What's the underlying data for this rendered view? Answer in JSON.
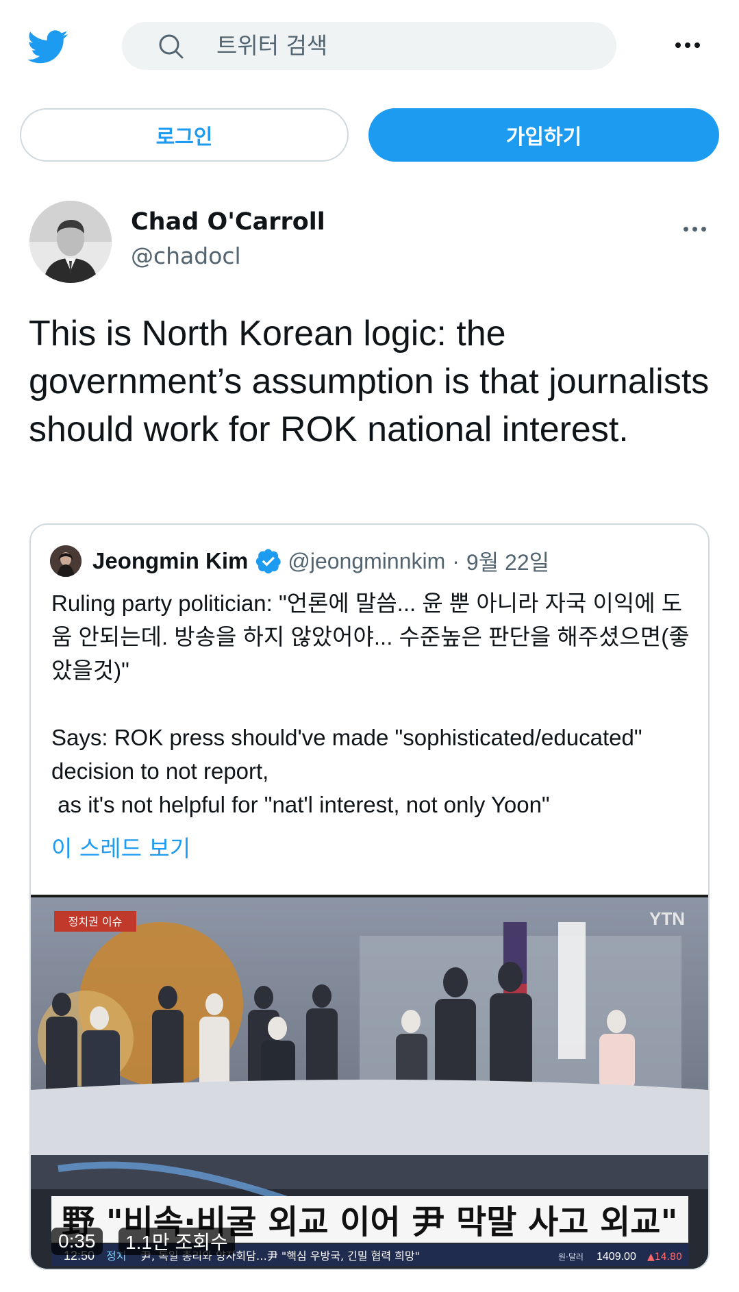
{
  "header": {
    "search_placeholder": "트위터 검색",
    "icons": [
      "twitter-bird-icon",
      "search-icon",
      "more-icon"
    ]
  },
  "auth": {
    "login_label": "로그인",
    "signup_label": "가입하기"
  },
  "tweet": {
    "author_name": "Chad O'Carroll",
    "author_handle": "@chadocl",
    "text": "This is North Korean logic: the government’s assumption is that journalists should work for ROK national interest."
  },
  "quoted": {
    "author_name": "Jeongmin Kim",
    "verified": true,
    "author_handle": "@jeongminnkim",
    "separator": "·",
    "date": "9월 22일",
    "text": "Ruling party politician: \"언론에 말씀... 윤 뿐 아니라 자국 이익에 도움 안되는데. 방송을 하지 않았어야... 수준높은 판단을 해주셨으면(좋았을것)\"\n\nSays: ROK press should've made \"sophisticated/educated\" decision to not report,\n as it's not helpful for \"nat'l interest, not only Yoon\"",
    "show_thread_label": "이 스레드 보기",
    "video": {
      "elapsed": "0:35",
      "views": "1.1만 조회수",
      "broadcaster": "YTN",
      "segment_tag": "정치권 이슈",
      "headline": "野 \"비속·비굴 외교 이어 尹 막말 사고 외교\"",
      "clock": "12:50",
      "ticker_label": "정치",
      "ticker": "尹, 독일 총리와 양자회담…尹 \"핵심 우방국, 긴밀 협력 희망\"",
      "market_label": "원·달러",
      "market_value": "1409.00",
      "market_change": "▲14.80"
    }
  },
  "colors": {
    "accent": "#1d9bf0",
    "text": "#0f1419",
    "secondary": "#536471",
    "border": "#cfd9de",
    "search_bg": "#eff3f4"
  }
}
